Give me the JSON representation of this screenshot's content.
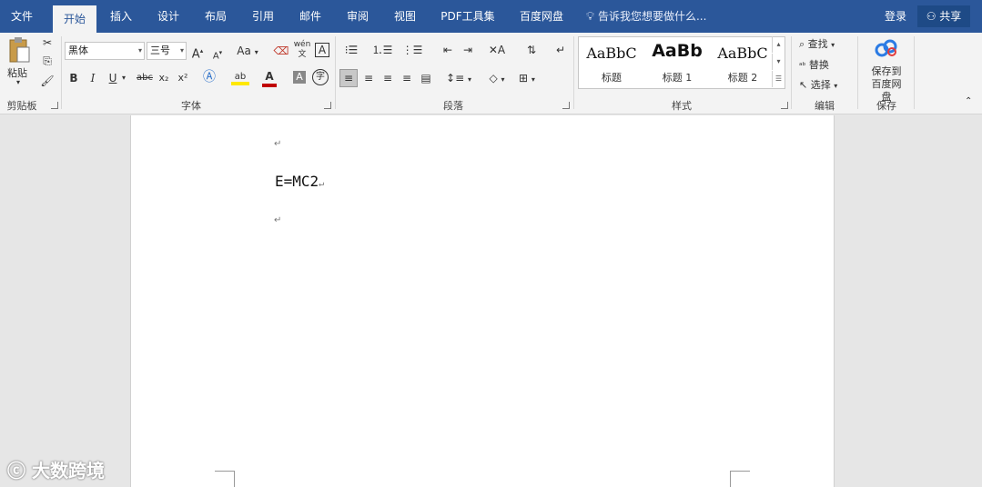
{
  "tabs": [
    {
      "label": "文件"
    },
    {
      "label": "开始"
    },
    {
      "label": "插入"
    },
    {
      "label": "设计"
    },
    {
      "label": "布局"
    },
    {
      "label": "引用"
    },
    {
      "label": "邮件"
    },
    {
      "label": "审阅"
    },
    {
      "label": "视图"
    },
    {
      "label": "PDF工具集"
    },
    {
      "label": "百度网盘"
    }
  ],
  "tell_me": "告诉我您想要做什么...",
  "login": "登录",
  "share": "共享",
  "clipboard": {
    "paste": "粘贴",
    "label": "剪贴板"
  },
  "font": {
    "name": "黑体",
    "size": "三号",
    "case": "Aa",
    "label": "字体",
    "bold": "B",
    "italic": "I",
    "underline": "U",
    "strike": "abc",
    "sub": "x₂",
    "sup": "x²",
    "wen": "wén",
    "grow": "A",
    "shrink": "A"
  },
  "paragraph": {
    "label": "段落"
  },
  "styles": {
    "label": "样式",
    "items": [
      {
        "sample": "AaBbC",
        "name": "标题"
      },
      {
        "sample": "AaBb",
        "name": "标题 1"
      },
      {
        "sample": "AaBbC",
        "name": "标题 2"
      }
    ]
  },
  "editing": {
    "find": "查找",
    "replace": "替换",
    "select": "选择",
    "label": "编辑"
  },
  "save": {
    "line1": "保存到",
    "line2": "百度网盘",
    "label": "保存"
  },
  "document": {
    "equation": "E=MC2",
    "mark": "↵"
  },
  "watermark": "大数跨境"
}
